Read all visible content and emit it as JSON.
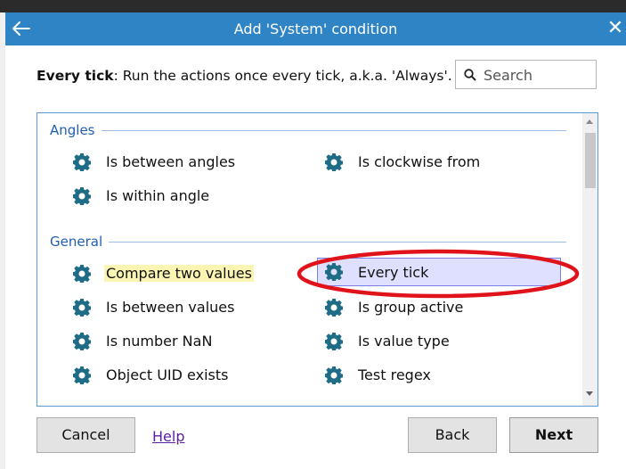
{
  "dialog": {
    "title": "Add 'System' condition",
    "back_icon": "arrow-left-icon",
    "close_label": "✕",
    "close_icon": "close-icon"
  },
  "description": {
    "name": "Every tick",
    "text": ": Run the actions once every tick, a.k.a. 'Always'."
  },
  "search": {
    "placeholder": "Search",
    "value": "",
    "icon": "search-icon"
  },
  "groups": [
    {
      "name": "Angles",
      "items": [
        {
          "label": "Is between angles",
          "icon": "gear-icon"
        },
        {
          "label": "Is clockwise from",
          "icon": "gear-icon"
        },
        {
          "label": "Is within angle",
          "icon": "gear-icon"
        }
      ]
    },
    {
      "name": "General",
      "items": [
        {
          "label": "Compare two values",
          "icon": "gear-icon",
          "highlighted": true
        },
        {
          "label": "Every tick",
          "icon": "gear-icon",
          "selected": true
        },
        {
          "label": "Is between values",
          "icon": "gear-icon"
        },
        {
          "label": "Is group active",
          "icon": "gear-icon"
        },
        {
          "label": "Is number NaN",
          "icon": "gear-icon"
        },
        {
          "label": "Is value type",
          "icon": "gear-icon"
        },
        {
          "label": "Object UID exists",
          "icon": "gear-icon"
        },
        {
          "label": "Test regex",
          "icon": "gear-icon"
        }
      ]
    }
  ],
  "footer": {
    "cancel_label": "Cancel",
    "help_label": "Help",
    "back_label": "Back",
    "next_label": "Next"
  },
  "colors": {
    "titlebar": "#2f84c5",
    "gear": "#1e6c86",
    "group_header": "#1f5fae",
    "selection_bg": "#dfe0ff",
    "highlight_bg": "#fbf5b4",
    "annotation_ring": "#e0131a"
  }
}
